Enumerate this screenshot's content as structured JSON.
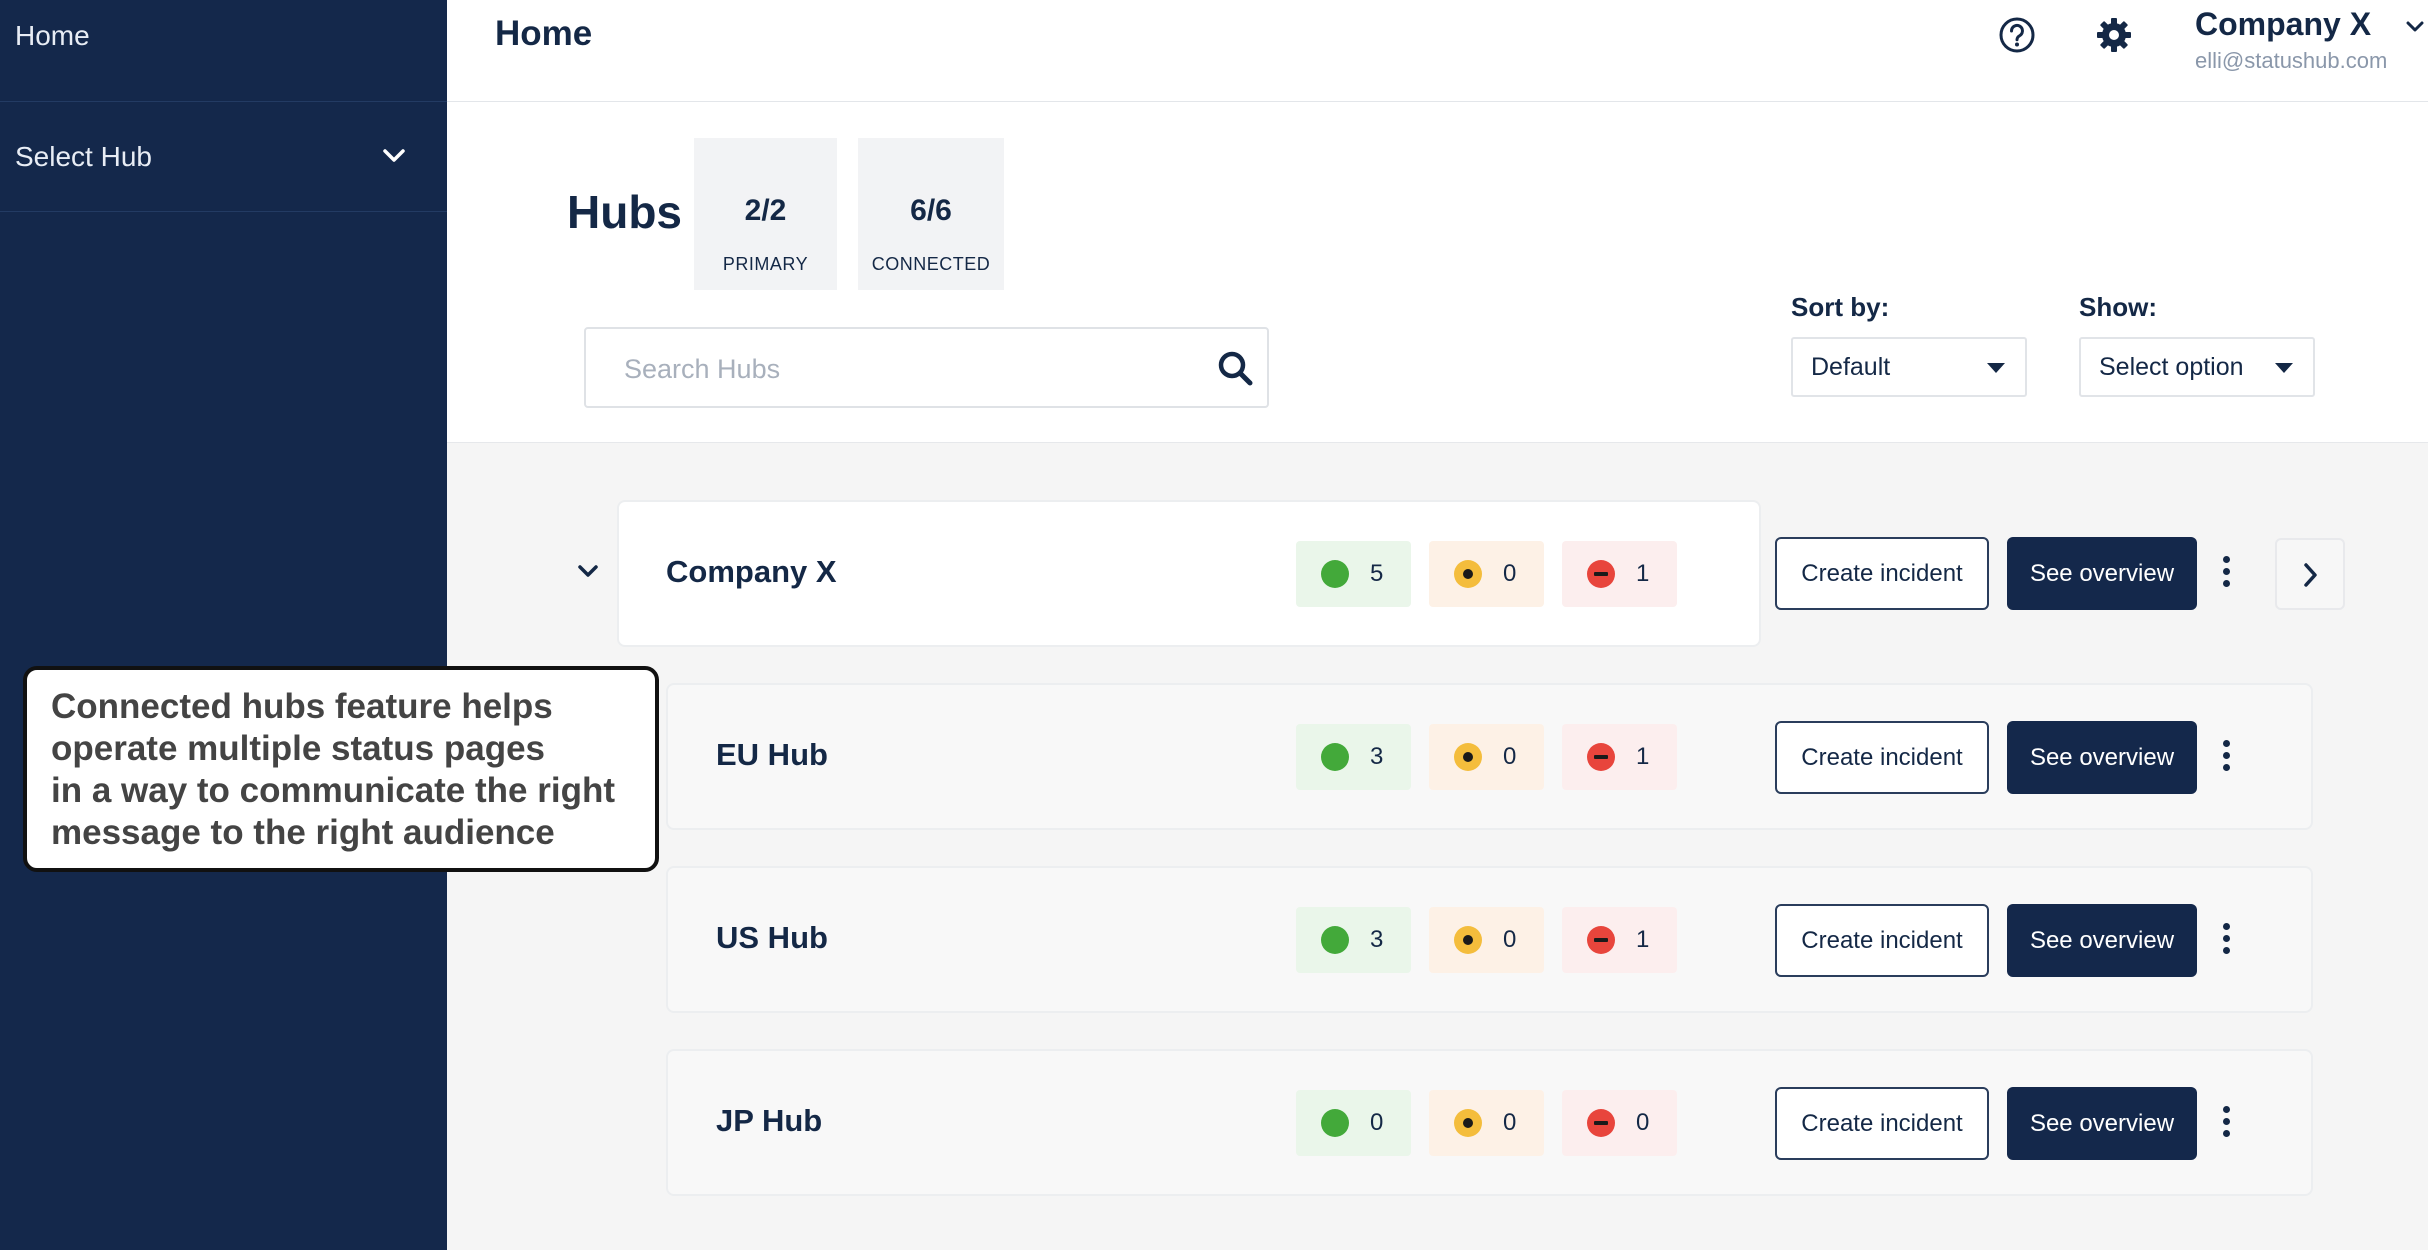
{
  "sidebar": {
    "home_label": "Home",
    "select_hub_label": "Select Hub"
  },
  "header": {
    "title": "Home",
    "account": {
      "name": "Company X",
      "email": "elli@statushub.com"
    }
  },
  "hubs_summary": {
    "title": "Hubs",
    "stats": [
      {
        "value": "2/2",
        "label": "PRIMARY"
      },
      {
        "value": "6/6",
        "label": "CONNECTED"
      }
    ],
    "search": {
      "placeholder": "Search Hubs",
      "value": ""
    },
    "sort": {
      "label": "Sort by:",
      "selected": "Default"
    },
    "show": {
      "label": "Show:",
      "selected": "Select option"
    }
  },
  "hubs": [
    {
      "name": "Company X",
      "operational": "5",
      "degraded": "0",
      "outage": "1",
      "create_label": "Create incident",
      "overview_label": "See overview"
    },
    {
      "name": "EU Hub",
      "operational": "3",
      "degraded": "0",
      "outage": "1",
      "create_label": "Create incident",
      "overview_label": "See overview"
    },
    {
      "name": "US Hub",
      "operational": "3",
      "degraded": "0",
      "outage": "1",
      "create_label": "Create incident",
      "overview_label": "See overview"
    },
    {
      "name": "JP Hub",
      "operational": "0",
      "degraded": "0",
      "outage": "0",
      "create_label": "Create incident",
      "overview_label": "See overview"
    }
  ],
  "callout": {
    "lines": [
      "Connected hubs feature helps",
      "operate multiple status pages",
      "in a way to communicate the right",
      "message to the right audience"
    ]
  },
  "colors": {
    "navy": "#14284b",
    "operational": "#43a93a",
    "degraded": "#f4bd3c",
    "outage": "#e8453c"
  },
  "icons": {
    "help": "question-circle-icon",
    "settings": "gear-icon",
    "search": "search-icon",
    "collapse": "chevron-down-icon",
    "next": "chevron-right-icon",
    "menu": "kebab-menu-icon"
  }
}
